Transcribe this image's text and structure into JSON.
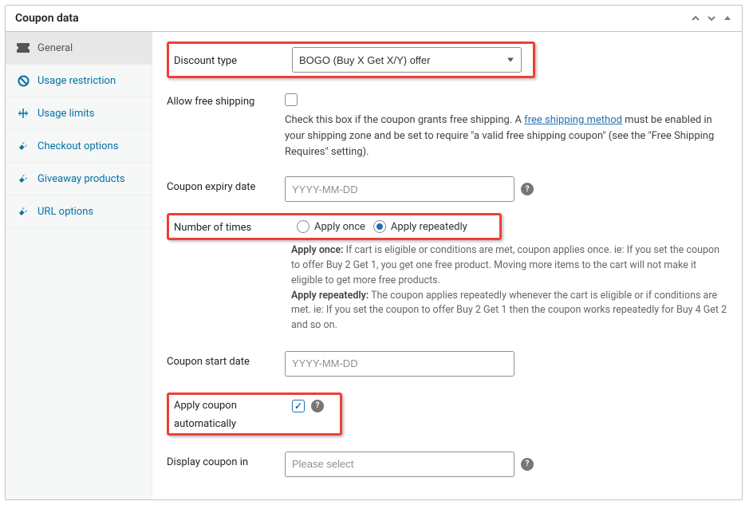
{
  "panel": {
    "title": "Coupon data"
  },
  "sidebar": {
    "items": [
      {
        "label": "General"
      },
      {
        "label": "Usage restriction"
      },
      {
        "label": "Usage limits"
      },
      {
        "label": "Checkout options"
      },
      {
        "label": "Giveaway products"
      },
      {
        "label": "URL options"
      }
    ]
  },
  "form": {
    "discount_type": {
      "label": "Discount type",
      "value": "BOGO (Buy X Get X/Y) offer"
    },
    "free_shipping": {
      "label": "Allow free shipping",
      "desc_prefix": "Check this box if the coupon grants free shipping. A ",
      "desc_link": "free shipping method",
      "desc_suffix": " must be enabled in your shipping zone and be set to require \"a valid free shipping coupon\" (see the \"Free Shipping Requires\" setting)."
    },
    "expiry": {
      "label": "Coupon expiry date",
      "placeholder": "YYYY-MM-DD"
    },
    "times": {
      "label": "Number of times",
      "opt_once": "Apply once",
      "opt_repeat": "Apply repeatedly",
      "explain_once_label": "Apply once:",
      "explain_once": " If cart is eligible or conditions are met, coupon applies once. ie: If you set the coupon to offer Buy 2 Get 1, you get one free product. Moving more items to the cart will not make it eligible to get more free products.",
      "explain_repeat_label": "Apply repeatedly:",
      "explain_repeat": " The coupon applies repeatedly whenever the cart is eligible or if conditions are met. ie: If you set the coupon to offer Buy 2 Get 1 then the coupon works repeatedly for Buy 4 Get 2 and so on."
    },
    "start": {
      "label": "Coupon start date",
      "placeholder": "YYYY-MM-DD"
    },
    "auto": {
      "label_1": "Apply coupon",
      "label_2": "automatically"
    },
    "display_in": {
      "label": "Display coupon in",
      "placeholder": "Please select"
    }
  }
}
